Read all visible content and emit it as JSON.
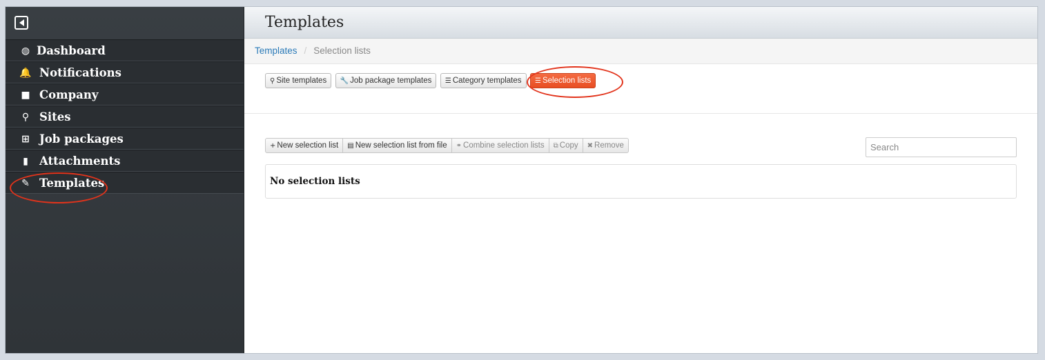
{
  "sidebar": {
    "items": [
      {
        "label": "Dashboard",
        "icon": "dashboard-icon",
        "glyph": "◍"
      },
      {
        "label": "Notifications",
        "icon": "bell-icon",
        "glyph": "🔔"
      },
      {
        "label": "Company",
        "icon": "briefcase-icon",
        "glyph": "■"
      },
      {
        "label": "Sites",
        "icon": "map-marker-icon",
        "glyph": "⚲"
      },
      {
        "label": "Job packages",
        "icon": "sitemap-icon",
        "glyph": "⊞"
      },
      {
        "label": "Attachments",
        "icon": "file-icon",
        "glyph": "▮"
      },
      {
        "label": "Templates",
        "icon": "pencil-icon",
        "glyph": "✎"
      }
    ]
  },
  "header": {
    "title": "Templates"
  },
  "breadcrumb": {
    "parent": "Templates",
    "separator": "/",
    "current": "Selection lists"
  },
  "tabs": [
    {
      "label": "Site templates",
      "icon": "map-marker-icon",
      "glyph": "⚲"
    },
    {
      "label": "Job package templates",
      "icon": "wrench-icon",
      "glyph": "🔧"
    },
    {
      "label": "Category templates",
      "icon": "list-icon",
      "glyph": "☰"
    },
    {
      "label": "Selection lists",
      "icon": "list-icon",
      "glyph": "☰",
      "active": true
    }
  ],
  "toolbar": {
    "new_selection_list": {
      "label": "New selection list",
      "glyph": "+"
    },
    "new_from_file": {
      "label": "New selection list from file",
      "glyph": "▤"
    },
    "combine": {
      "label": "Combine selection lists",
      "glyph": "⚭"
    },
    "copy": {
      "label": "Copy",
      "glyph": "⧉"
    },
    "remove": {
      "label": "Remove",
      "glyph": "✖"
    }
  },
  "search": {
    "placeholder": "Search"
  },
  "empty_state": {
    "text": "No selection lists"
  },
  "colors": {
    "active_tab": "#e9532a",
    "annotation": "#e2331b",
    "link": "#2a7ab8"
  }
}
